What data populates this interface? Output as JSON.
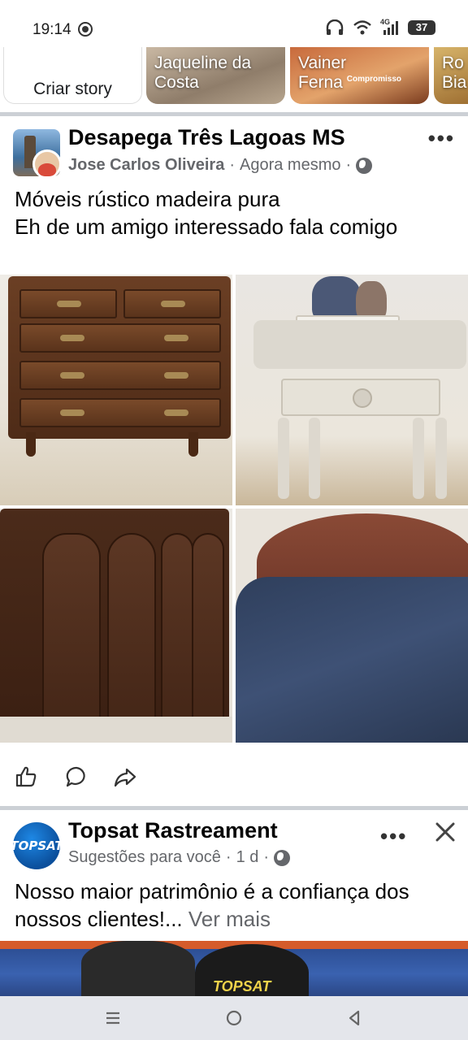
{
  "status_bar": {
    "time": "19:14",
    "network": "4G",
    "battery": "37"
  },
  "stories": {
    "create_label": "Criar story",
    "items": [
      {
        "name": "Jaqueline da\nCosta"
      },
      {
        "name": "Vainer\nFerna",
        "tag": "Compromisso"
      },
      {
        "name": "Ro\nBia"
      }
    ]
  },
  "post": {
    "group": "Desapega Três Lagoas MS",
    "author": "Jose Carlos Oliveira",
    "time": "Agora mesmo",
    "separator": "·",
    "text": "Móveis rústico madeira pura\nEh de um amigo interessado fala comigo"
  },
  "ad": {
    "name": "Topsat Rastreament",
    "meta": "Sugestões para você",
    "time": "1 d",
    "separator": "·",
    "avatar_text": "TOPSAT",
    "text": "Nosso maior patrimônio é a confiança dos nossos clientes!...",
    "see_more": "Ver mais",
    "image_logo": "TOPSAT"
  },
  "icons": {
    "like": "like-icon",
    "comment": "comment-icon",
    "share": "share-icon",
    "more": "more-icon",
    "close": "close-icon",
    "globe": "globe-icon"
  },
  "colors": {
    "text": "#050505",
    "secondary_text": "#65676b",
    "divider": "#ccd0d5",
    "nav_bar": "#e4e6eb",
    "brand_blue": "#1e88e5"
  }
}
